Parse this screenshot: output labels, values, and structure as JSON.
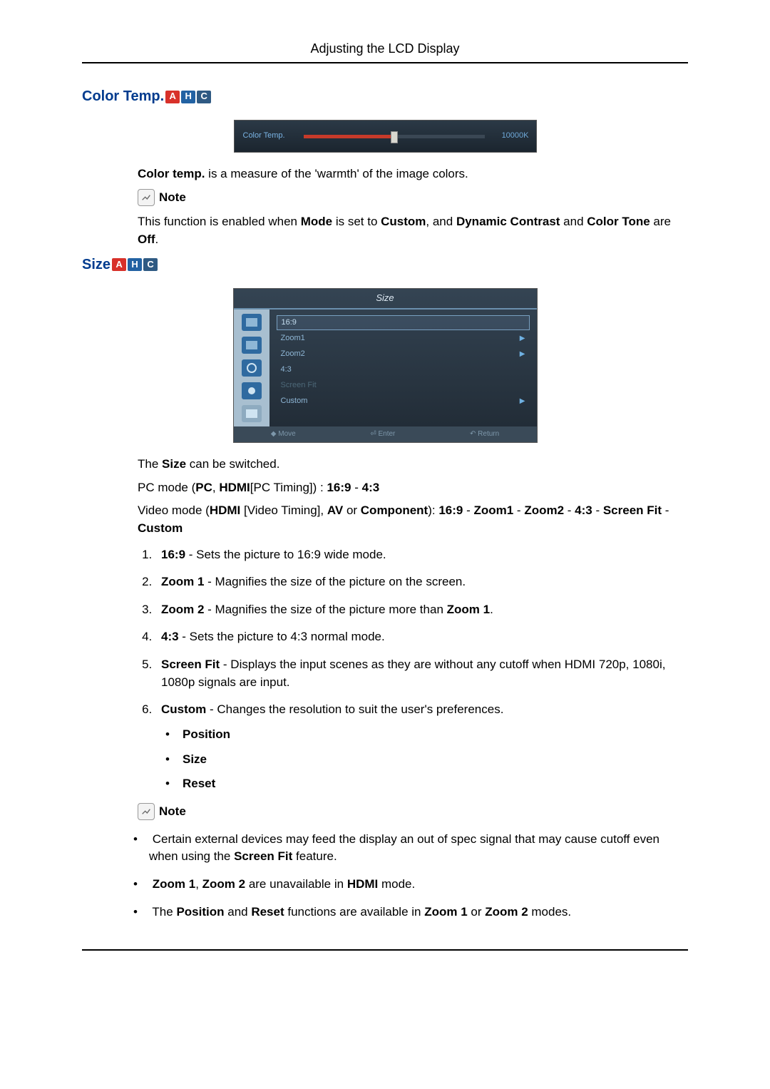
{
  "page_header": "Adjusting the LCD Display",
  "color_temp": {
    "heading": "Color Temp.",
    "badges": [
      "A",
      "H",
      "C"
    ],
    "panel": {
      "label": "Color Temp.",
      "value": "10000K",
      "percent": 50
    },
    "desc_prefix": "Color temp.",
    "desc_rest": " is a measure of the 'warmth' of the image colors.",
    "note_label": "Note",
    "note_text_1": "This function is enabled when ",
    "note_mode": "Mode",
    "note_text_2": " is set to ",
    "note_custom": "Custom",
    "note_text_3": ", and ",
    "note_dc": "Dynamic Contrast",
    "note_text_4": " and ",
    "note_ct": "Color Tone",
    "note_text_5": " are ",
    "note_off": "Off",
    "note_text_6": "."
  },
  "size": {
    "heading": "Size",
    "badges": [
      "A",
      "H",
      "C"
    ],
    "panel_title": "Size",
    "panel_items": [
      {
        "label": "16:9",
        "selected": true,
        "dim": false,
        "arrow": false
      },
      {
        "label": "Zoom1",
        "selected": false,
        "dim": false,
        "arrow": true
      },
      {
        "label": "Zoom2",
        "selected": false,
        "dim": false,
        "arrow": true
      },
      {
        "label": "4:3",
        "selected": false,
        "dim": false,
        "arrow": false
      },
      {
        "label": "Screen Fit",
        "selected": false,
        "dim": true,
        "arrow": false
      },
      {
        "label": "Custom",
        "selected": false,
        "dim": false,
        "arrow": true
      }
    ],
    "panel_footer": {
      "move": "Move",
      "enter": "Enter",
      "return": "Return"
    },
    "line1_a": "The ",
    "line1_b": "Size",
    "line1_c": " can be switched.",
    "pc_1": "PC mode (",
    "pc_pc": "PC",
    "pc_2": ", ",
    "pc_hdmi": "HDMI",
    "pc_3": "[PC Timing]) : ",
    "pc_169": "16:9",
    "pc_4": " - ",
    "pc_43": "4:3",
    "vm_1": "Video mode (",
    "vm_hdmi": "HDMI",
    "vm_2": " [Video Timing], ",
    "vm_av": "AV",
    "vm_3": " or ",
    "vm_comp": "Component",
    "vm_4": "): ",
    "vm_169": "16:9",
    "vm_dash": " - ",
    "vm_z1": "Zoom1",
    "vm_z2": "Zoom2",
    "vm_43": "4:3",
    "vm_sf": "Screen Fit",
    "vm_cu": "Custom",
    "items": {
      "i1_b": "16:9",
      "i1_r": " - Sets the picture to 16:9 wide mode.",
      "i2_b": "Zoom 1",
      "i2_r": " - Magnifies the size of the picture on the screen.",
      "i3_b": "Zoom 2",
      "i3_r1": " - Magnifies the size of the picture more than ",
      "i3_b2": "Zoom 1",
      "i3_r2": ".",
      "i4_b": "4:3",
      "i4_r": " - Sets the picture to 4:3 normal mode.",
      "i5_b": "Screen Fit",
      "i5_r": " - Displays the input scenes as they are without any cutoff when HDMI 720p, 1080i, 1080p signals are input.",
      "i6_b": "Custom",
      "i6_r": " - Changes the resolution to suit the user's preferences.",
      "i6_sub": [
        "Position",
        "Size",
        "Reset"
      ]
    },
    "note_label": "Note",
    "notes": {
      "n1_a": "Certain external devices may feed the display an out of spec signal that may cause cutoff even when using the ",
      "n1_b": "Screen Fit",
      "n1_c": " feature.",
      "n2_a": "Zoom 1",
      "n2_b": ", ",
      "n2_c": "Zoom 2",
      "n2_d": " are unavailable in ",
      "n2_e": "HDMI",
      "n2_f": " mode.",
      "n3_a": "The ",
      "n3_b": "Position",
      "n3_c": " and ",
      "n3_d": "Reset",
      "n3_e": " functions are available in ",
      "n3_f": "Zoom 1",
      "n3_g": " or ",
      "n3_h": "Zoom 2",
      "n3_i": " modes."
    }
  }
}
